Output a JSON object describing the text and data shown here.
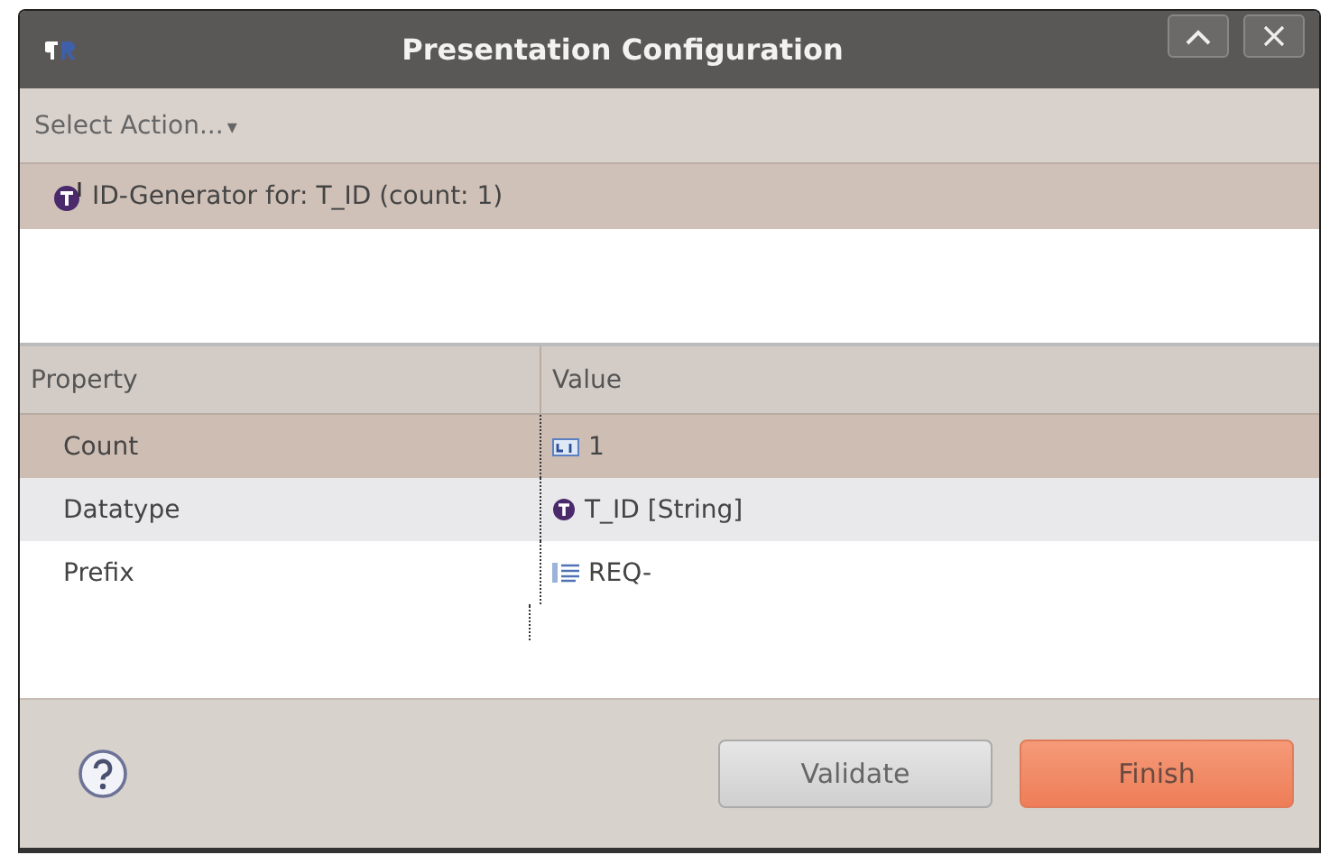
{
  "window": {
    "title": "Presentation Configuration"
  },
  "action_menu": {
    "label": "Select Action...",
    "arrow": "▾"
  },
  "tree": {
    "items": [
      {
        "label": "ID-Generator for: T_ID (count: 1)",
        "selected": true
      }
    ]
  },
  "table": {
    "columns": [
      "Property",
      "Value"
    ],
    "rows": [
      {
        "property": "Count",
        "value": "1",
        "kind": "number",
        "selected": true
      },
      {
        "property": "Datatype",
        "value": "T_ID [String]",
        "kind": "type",
        "selected": false
      },
      {
        "property": "Prefix",
        "value": "REQ-",
        "kind": "text",
        "selected": false
      }
    ]
  },
  "buttons": [
    {
      "label": "Validate",
      "kind": "secondary"
    },
    {
      "label": "Finish",
      "kind": "primary"
    }
  ]
}
